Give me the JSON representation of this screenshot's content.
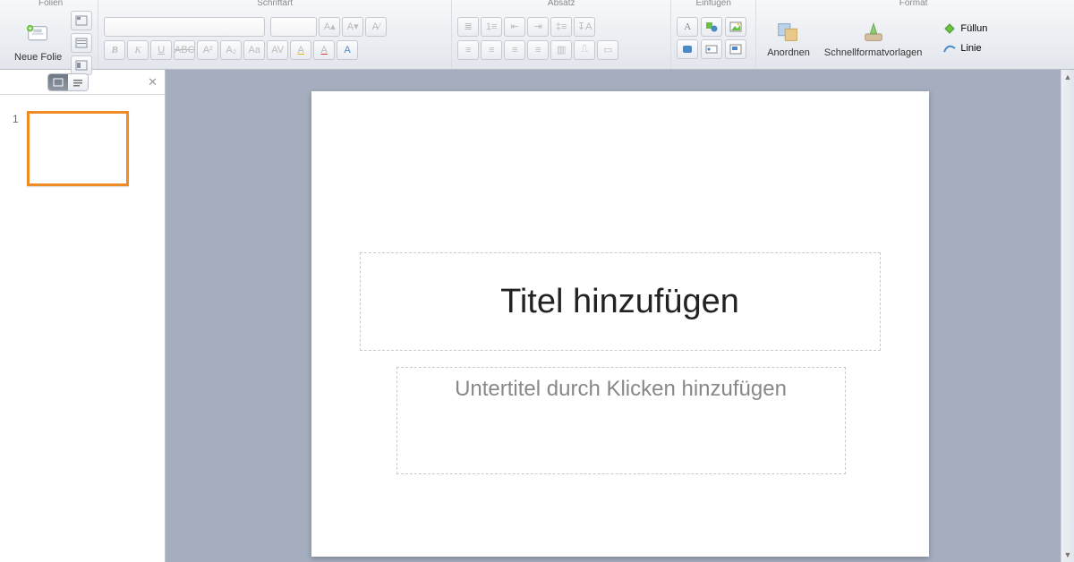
{
  "ribbon": {
    "groups": {
      "folien": {
        "label": "Folien",
        "new_slide": "Neue Folie"
      },
      "schriftart": {
        "label": "Schriftart",
        "font_name_placeholder": "",
        "font_size_placeholder": ""
      },
      "absatz": {
        "label": "Absatz"
      },
      "einfugen": {
        "label": "Einfügen"
      },
      "format": {
        "label": "Format",
        "anordnen": "Anordnen",
        "schnellformat": "Schnellformatvorlagen",
        "fullen": "Füllun",
        "linie": "Linie"
      }
    }
  },
  "sidebar": {
    "slides": [
      {
        "number": "1"
      }
    ]
  },
  "slide": {
    "title_placeholder": "Titel hinzufügen",
    "subtitle_placeholder": "Untertitel durch Klicken hinzufügen"
  }
}
